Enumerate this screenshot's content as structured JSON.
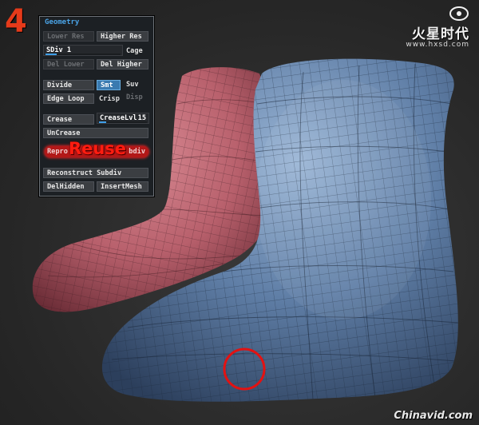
{
  "step": {
    "number": "4"
  },
  "watermark_top": {
    "brand": "火星时代",
    "site": "www.hxsd.com"
  },
  "watermark_bottom": {
    "text": "Chinavid.com"
  },
  "callout": {
    "text": "Reuse",
    "color": "#ff1c10"
  },
  "palette": {
    "title": "Geometry",
    "lower_res": "Lower Res",
    "higher_res": "Higher Res",
    "sdiv": {
      "label": "SDiv",
      "value": "1",
      "level": 0.15
    },
    "cage": "Cage",
    "del_lower": "Del Lower",
    "del_higher": "Del Higher",
    "divide": "Divide",
    "smt": "Smt",
    "suv": "Suv",
    "edge_loop": "Edge Loop",
    "crisp": "Crisp",
    "disp": "Disp",
    "crease": "Crease",
    "crease_lvl": {
      "label": "CreaseLvl",
      "value": "15",
      "level": 0.15
    },
    "uncrease": "UnCrease",
    "reproject_left": "Repro",
    "reproject_right": "bdiv",
    "reconstruct_subdiv": "Reconstruct Subdiv",
    "del_hidden": "DelHidden",
    "insert_mesh": "InsertMesh"
  },
  "colors": {
    "accent_blue": "#4aa3e6",
    "active_button": "#3a7ab0",
    "highlight_red": "#b21818",
    "boot_front": "#5f7ea6",
    "boot_back": "#b8606c"
  }
}
